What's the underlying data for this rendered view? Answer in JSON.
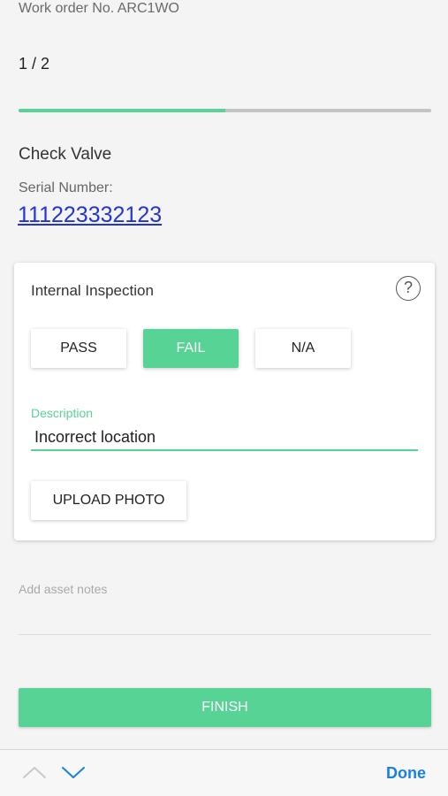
{
  "header": {
    "work_order": "Work order No. ARC1WO",
    "progress_text": "1 / 2",
    "progress_fraction": 0.5
  },
  "asset": {
    "name": "Check Valve",
    "serial_label": "Serial Number:",
    "serial_value": "111223332123"
  },
  "inspection": {
    "title": "Internal Inspection",
    "help_glyph": "?",
    "options": {
      "pass": "PASS",
      "fail": "FAIL",
      "na": "N/A"
    },
    "selected": "fail",
    "description_label": "Description",
    "description_value": "Incorrect location",
    "upload_label": "UPLOAD PHOTO"
  },
  "notes": {
    "placeholder": "Add asset notes"
  },
  "finish_label": "FINISH",
  "keyboard_toolbar": {
    "done_label": "Done"
  },
  "colors": {
    "accent": "#58d396",
    "link": "#2233d9",
    "done": "#1a80e0",
    "track": "#c4c4c4"
  },
  "icons": {
    "help": "help-icon",
    "prev": "chevron-up-icon",
    "next": "chevron-down-icon"
  }
}
